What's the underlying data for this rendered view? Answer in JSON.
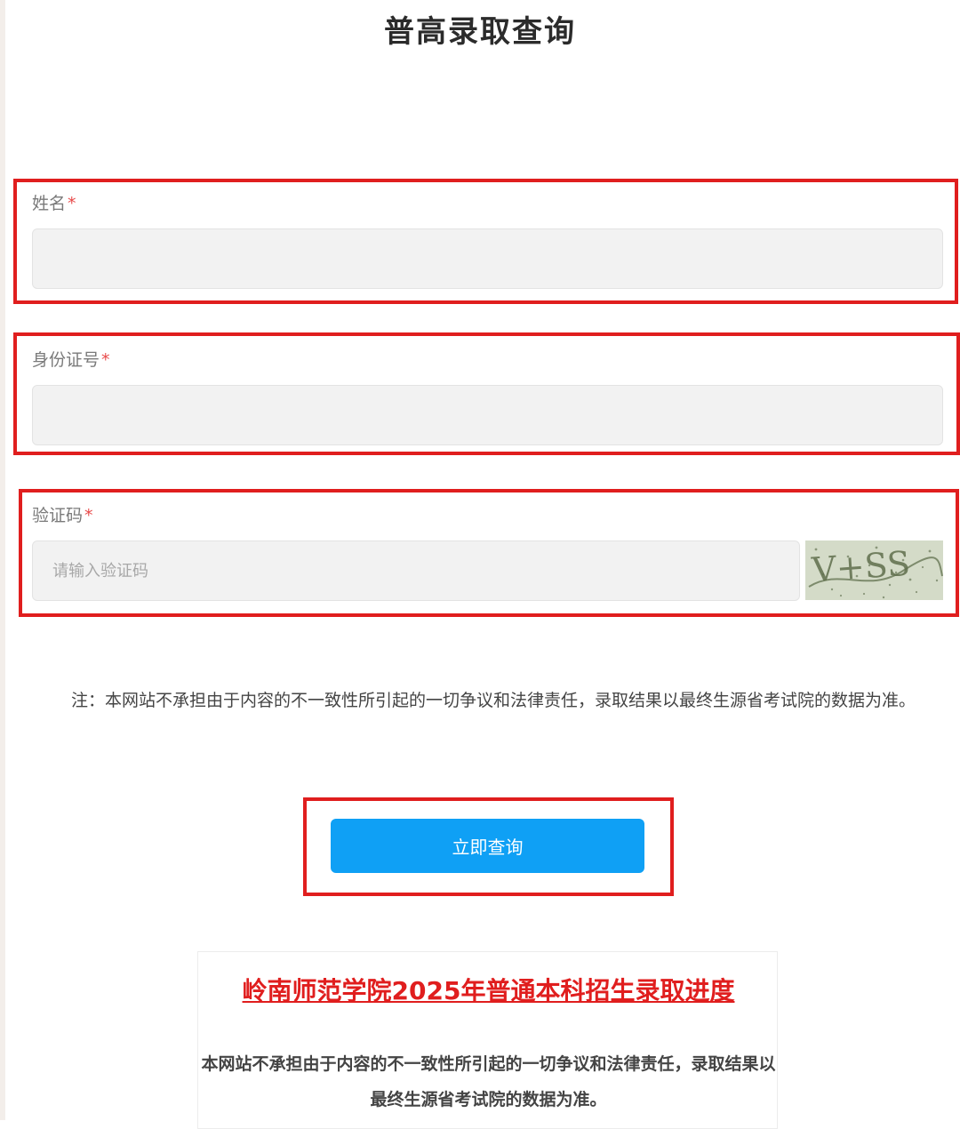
{
  "page": {
    "title": "普高录取查询"
  },
  "form": {
    "name": {
      "label": "姓名",
      "required_mark": "*",
      "value": "",
      "placeholder": ""
    },
    "id_number": {
      "label": "身份证号",
      "required_mark": "*",
      "value": "",
      "placeholder": ""
    },
    "captcha": {
      "label": "验证码",
      "required_mark": "*",
      "value": "",
      "placeholder": "请输入验证码",
      "image_text": "V+SS"
    }
  },
  "note": "注：本网站不承担由于内容的不一致性所引起的一切争议和法律责任，录取结果以最终生源省考试院的数据为准。",
  "submit_button": {
    "label": "立即查询"
  },
  "card": {
    "title": "岭南师范学院2025年普通本科招生录取进度",
    "body": "本网站不承担由于内容的不一致性所引起的一切争议和法律责任，录取结果以最终生源省考试院的数据为准。"
  },
  "colors": {
    "highlight": "#e01e1e",
    "button": "#0fa0f5",
    "required": "#e84a4a"
  }
}
